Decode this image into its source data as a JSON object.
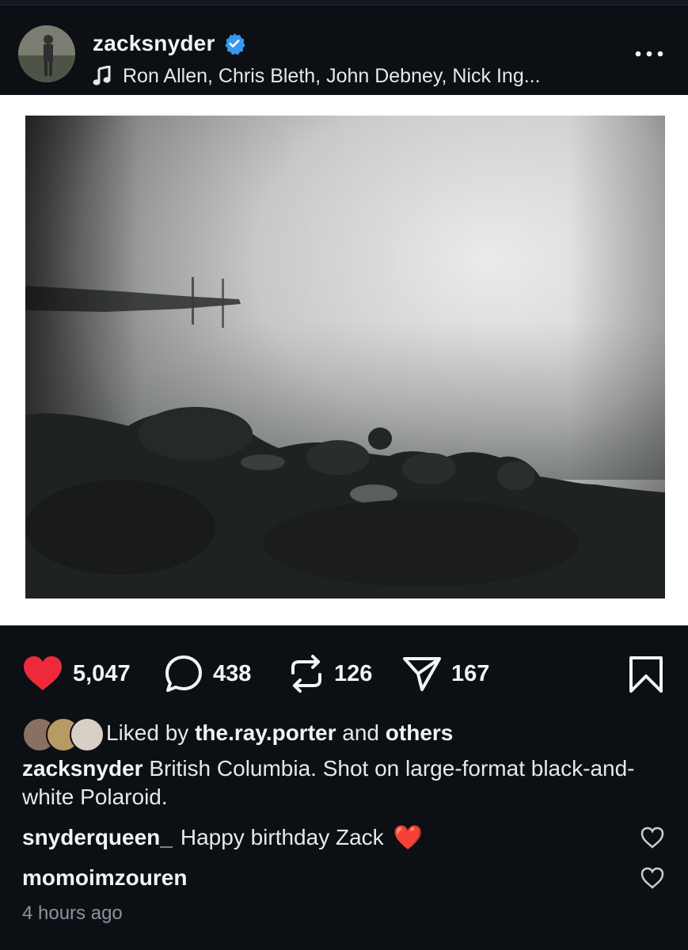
{
  "post": {
    "username": "zacksnyder",
    "verified": true,
    "audio_text": "Ron Allen, Chris Bleth, John Debney, Nick Ing...",
    "more_icon": "more-horizontal-icon"
  },
  "actions": {
    "likes": "5,047",
    "comments": "438",
    "reposts": "126",
    "shares": "167"
  },
  "liked_by": {
    "prefix": "Liked by",
    "user": "the.ray.porter",
    "middle": "and",
    "suffix": "others"
  },
  "caption": {
    "user": "zacksnyder",
    "text": "British Columbia. Shot on large-format black-and-white Polaroid."
  },
  "comments": [
    {
      "user": "snyderqueen_",
      "text": "Happy birthday Zack",
      "emoji": "❤️"
    },
    {
      "user": "momoimzouren",
      "text": ""
    }
  ],
  "timestamp": "4 hours ago",
  "colors": {
    "background": "#0c0f14",
    "like_red": "#ee2a3a",
    "verified_blue": "#3897f0",
    "muted_text": "#8e939b"
  }
}
